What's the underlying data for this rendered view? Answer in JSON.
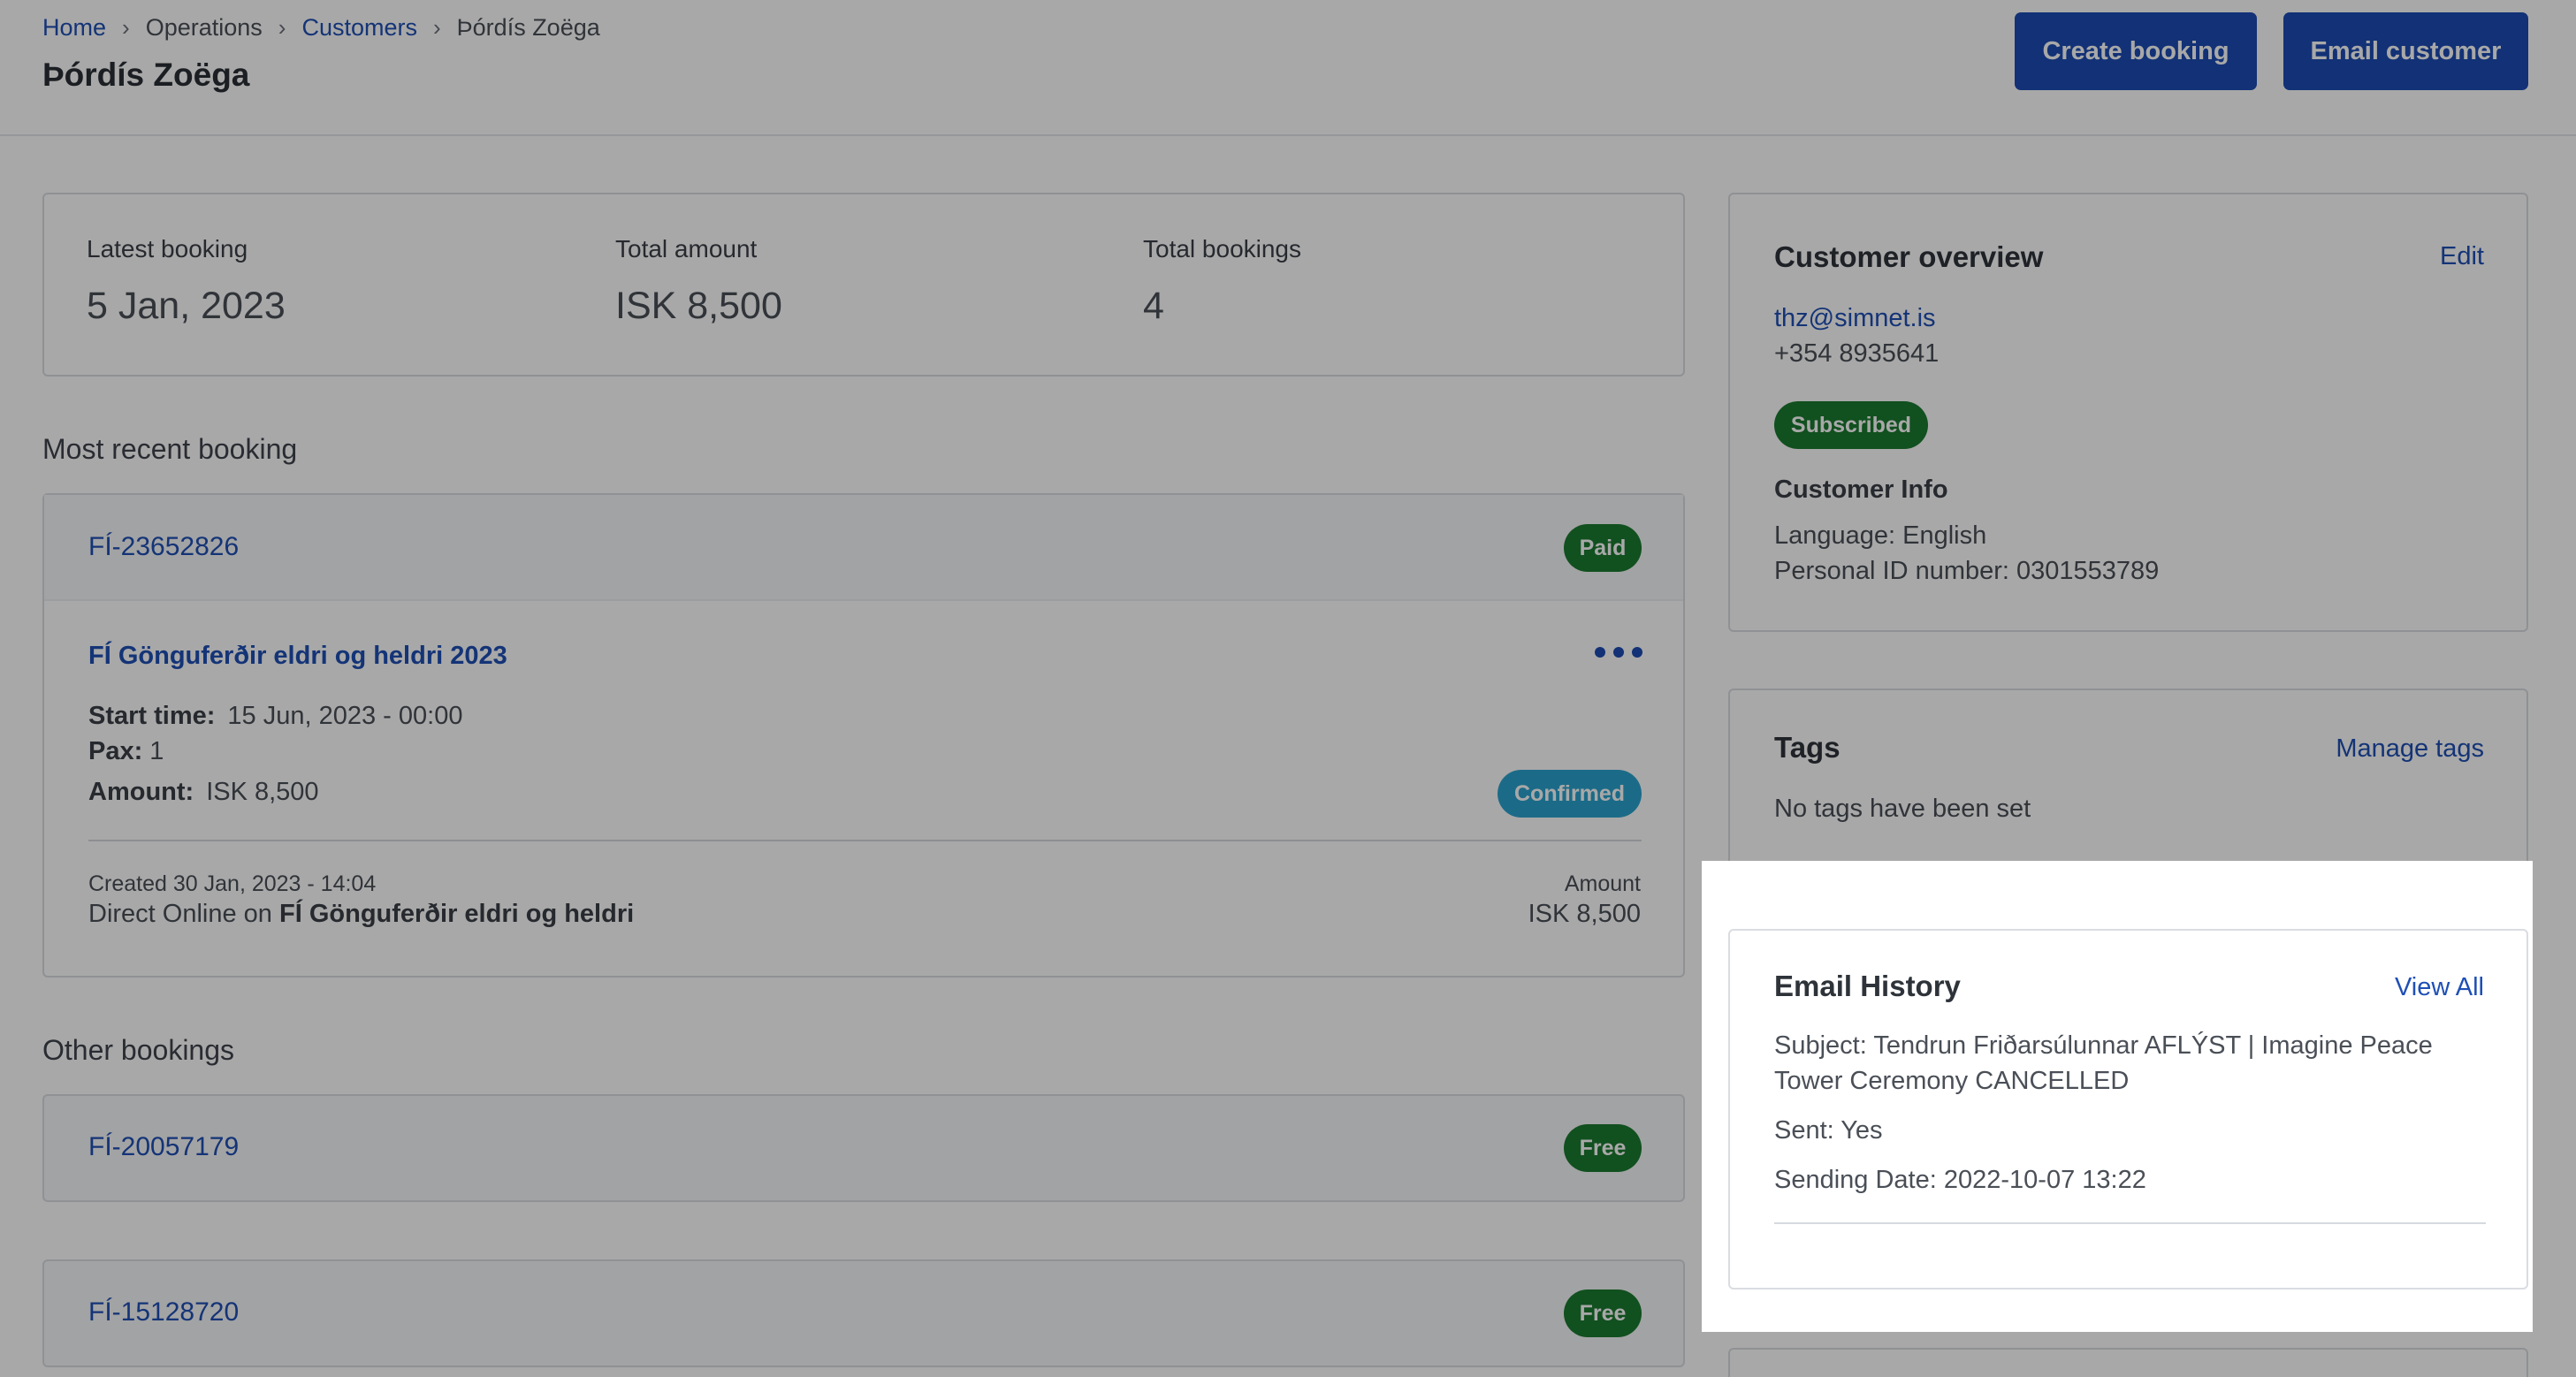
{
  "header": {
    "breadcrumb": {
      "home": "Home",
      "operations": "Operations",
      "customers": "Customers",
      "current": "Þórdís Zoëga",
      "separator": "›"
    },
    "title": "Þórdís Zoëga",
    "create_booking": "Create booking",
    "email_customer": "Email customer"
  },
  "stats": {
    "latest_label": "Latest booking",
    "latest_value": "5 Jan, 2023",
    "amount_label": "Total amount",
    "amount_value": "ISK 8,500",
    "bookings_label": "Total bookings",
    "bookings_value": "4"
  },
  "recent": {
    "section_title": "Most recent booking",
    "booking_id": "FÍ-23652826",
    "payment_status": "Paid",
    "product": "FÍ Gönguferðir eldri og heldri 2023",
    "start_label": "Start time:",
    "start_value": "15 Jun, 2023 - 00:00",
    "pax_label": "Pax:",
    "pax_value": "1",
    "amount_label": "Amount:",
    "amount_value": "ISK 8,500",
    "booking_status": "Confirmed",
    "created": "Created 30 Jan, 2023 - 14:04",
    "channel_prefix": "Direct Online on ",
    "channel_name": "FÍ Gönguferðir eldri og heldri",
    "footer_amount_label": "Amount",
    "footer_amount_value": "ISK 8,500"
  },
  "other": {
    "section_title": "Other bookings",
    "items": [
      {
        "id": "FÍ-20057179",
        "status": "Free"
      },
      {
        "id": "FÍ-15128720",
        "status": "Free"
      }
    ]
  },
  "customer": {
    "title": "Customer overview",
    "edit": "Edit",
    "email": "thz@simnet.is",
    "phone": "+354 8935641",
    "subscription": "Subscribed",
    "info_title": "Customer Info",
    "language": "Language: English",
    "personal_id": "Personal ID number: 0301553789"
  },
  "tags": {
    "title": "Tags",
    "manage": "Manage tags",
    "empty": "No tags have been set"
  },
  "email_history": {
    "title": "Email History",
    "view_all": "View All",
    "subject_line1": "Subject: Tendrun Friðarsúlunnar AFLÝST | Imagine Peace",
    "subject_line2": "Tower Ceremony CANCELLED",
    "sent": "Sent: Yes",
    "sending_date": "Sending Date: 2022-10-07 13:22"
  },
  "colors": {
    "primary": "#1c4bb4",
    "link": "#1f4fb5",
    "success": "#1a7a2f",
    "info": "#2aa3cf"
  }
}
